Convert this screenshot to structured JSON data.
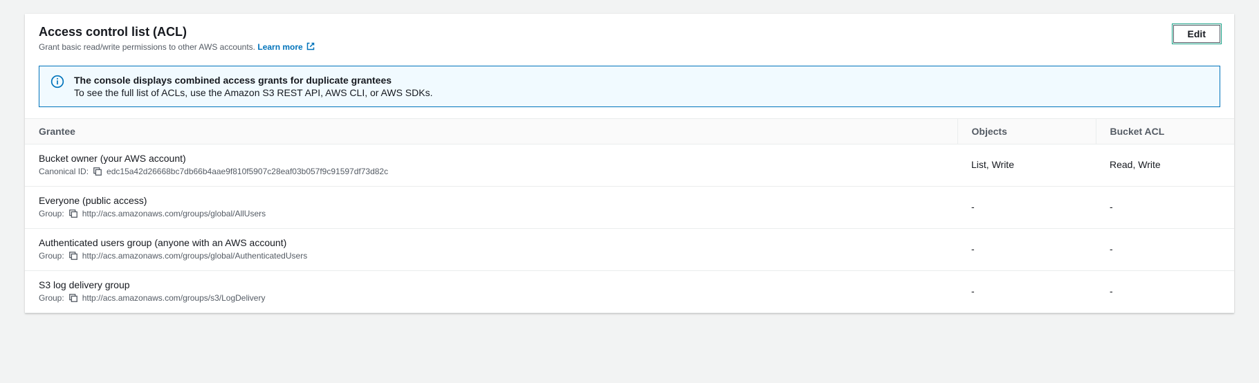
{
  "header": {
    "title": "Access control list (ACL)",
    "description": "Grant basic read/write permissions to other AWS accounts.",
    "learn_more": "Learn more",
    "edit_label": "Edit"
  },
  "info": {
    "title": "The console displays combined access grants for duplicate grantees",
    "body": "To see the full list of ACLs, use the Amazon S3 REST API, AWS CLI, or AWS SDKs."
  },
  "table": {
    "headers": {
      "grantee": "Grantee",
      "objects": "Objects",
      "bucket_acl": "Bucket ACL"
    },
    "rows": [
      {
        "name": "Bucket owner (your AWS account)",
        "sub_label": "Canonical ID:",
        "sub_value": "edc15a42d26668bc7db66b4aae9f810f5907c28eaf03b057f9c91597df73d82c",
        "objects": "List, Write",
        "bucket_acl": "Read, Write"
      },
      {
        "name": "Everyone (public access)",
        "sub_label": "Group:",
        "sub_value": "http://acs.amazonaws.com/groups/global/AllUsers",
        "objects": "-",
        "bucket_acl": "-"
      },
      {
        "name": "Authenticated users group (anyone with an AWS account)",
        "sub_label": "Group:",
        "sub_value": "http://acs.amazonaws.com/groups/global/AuthenticatedUsers",
        "objects": "-",
        "bucket_acl": "-"
      },
      {
        "name": "S3 log delivery group",
        "sub_label": "Group:",
        "sub_value": "http://acs.amazonaws.com/groups/s3/LogDelivery",
        "objects": "-",
        "bucket_acl": "-"
      }
    ]
  }
}
